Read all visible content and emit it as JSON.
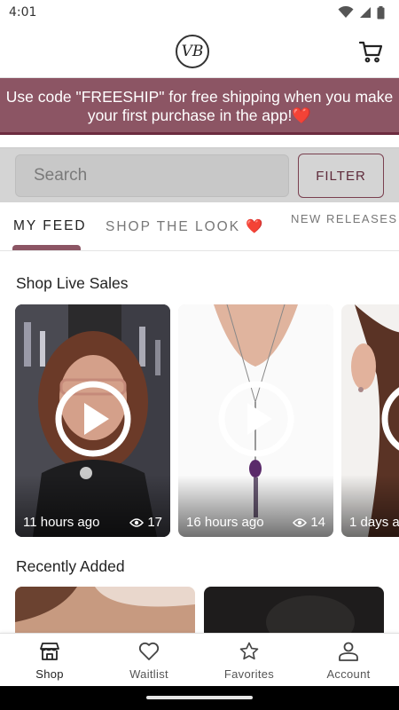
{
  "status": {
    "time": "4:01"
  },
  "header": {
    "logo_text": "VB"
  },
  "promo": {
    "text": "Use code \"FREESHIP\" for free shipping when you make your first purchase in the app!❤️"
  },
  "search": {
    "placeholder": "Search",
    "filter_label": "FILTER"
  },
  "tabs": [
    {
      "label": "MY FEED",
      "active": true
    },
    {
      "label": "SHOP THE LOOK ❤️",
      "active": false
    },
    {
      "label": "NEW RELEASES & ITEMS",
      "active": false
    }
  ],
  "live_sales": {
    "title": "Shop Live Sales",
    "cards": [
      {
        "time": "11 hours ago",
        "views": "17"
      },
      {
        "time": "16 hours ago",
        "views": "14"
      },
      {
        "time": "1 days a",
        "views": ""
      }
    ]
  },
  "recently_added": {
    "title": "Recently Added"
  },
  "nav": [
    {
      "label": "Shop",
      "icon": "store-icon",
      "active": true
    },
    {
      "label": "Waitlist",
      "icon": "heart-icon",
      "active": false
    },
    {
      "label": "Favorites",
      "icon": "star-icon",
      "active": false
    },
    {
      "label": "Account",
      "icon": "person-icon",
      "active": false
    }
  ],
  "colors": {
    "brand": "#8c5564",
    "brand_dark": "#6c2c40"
  }
}
